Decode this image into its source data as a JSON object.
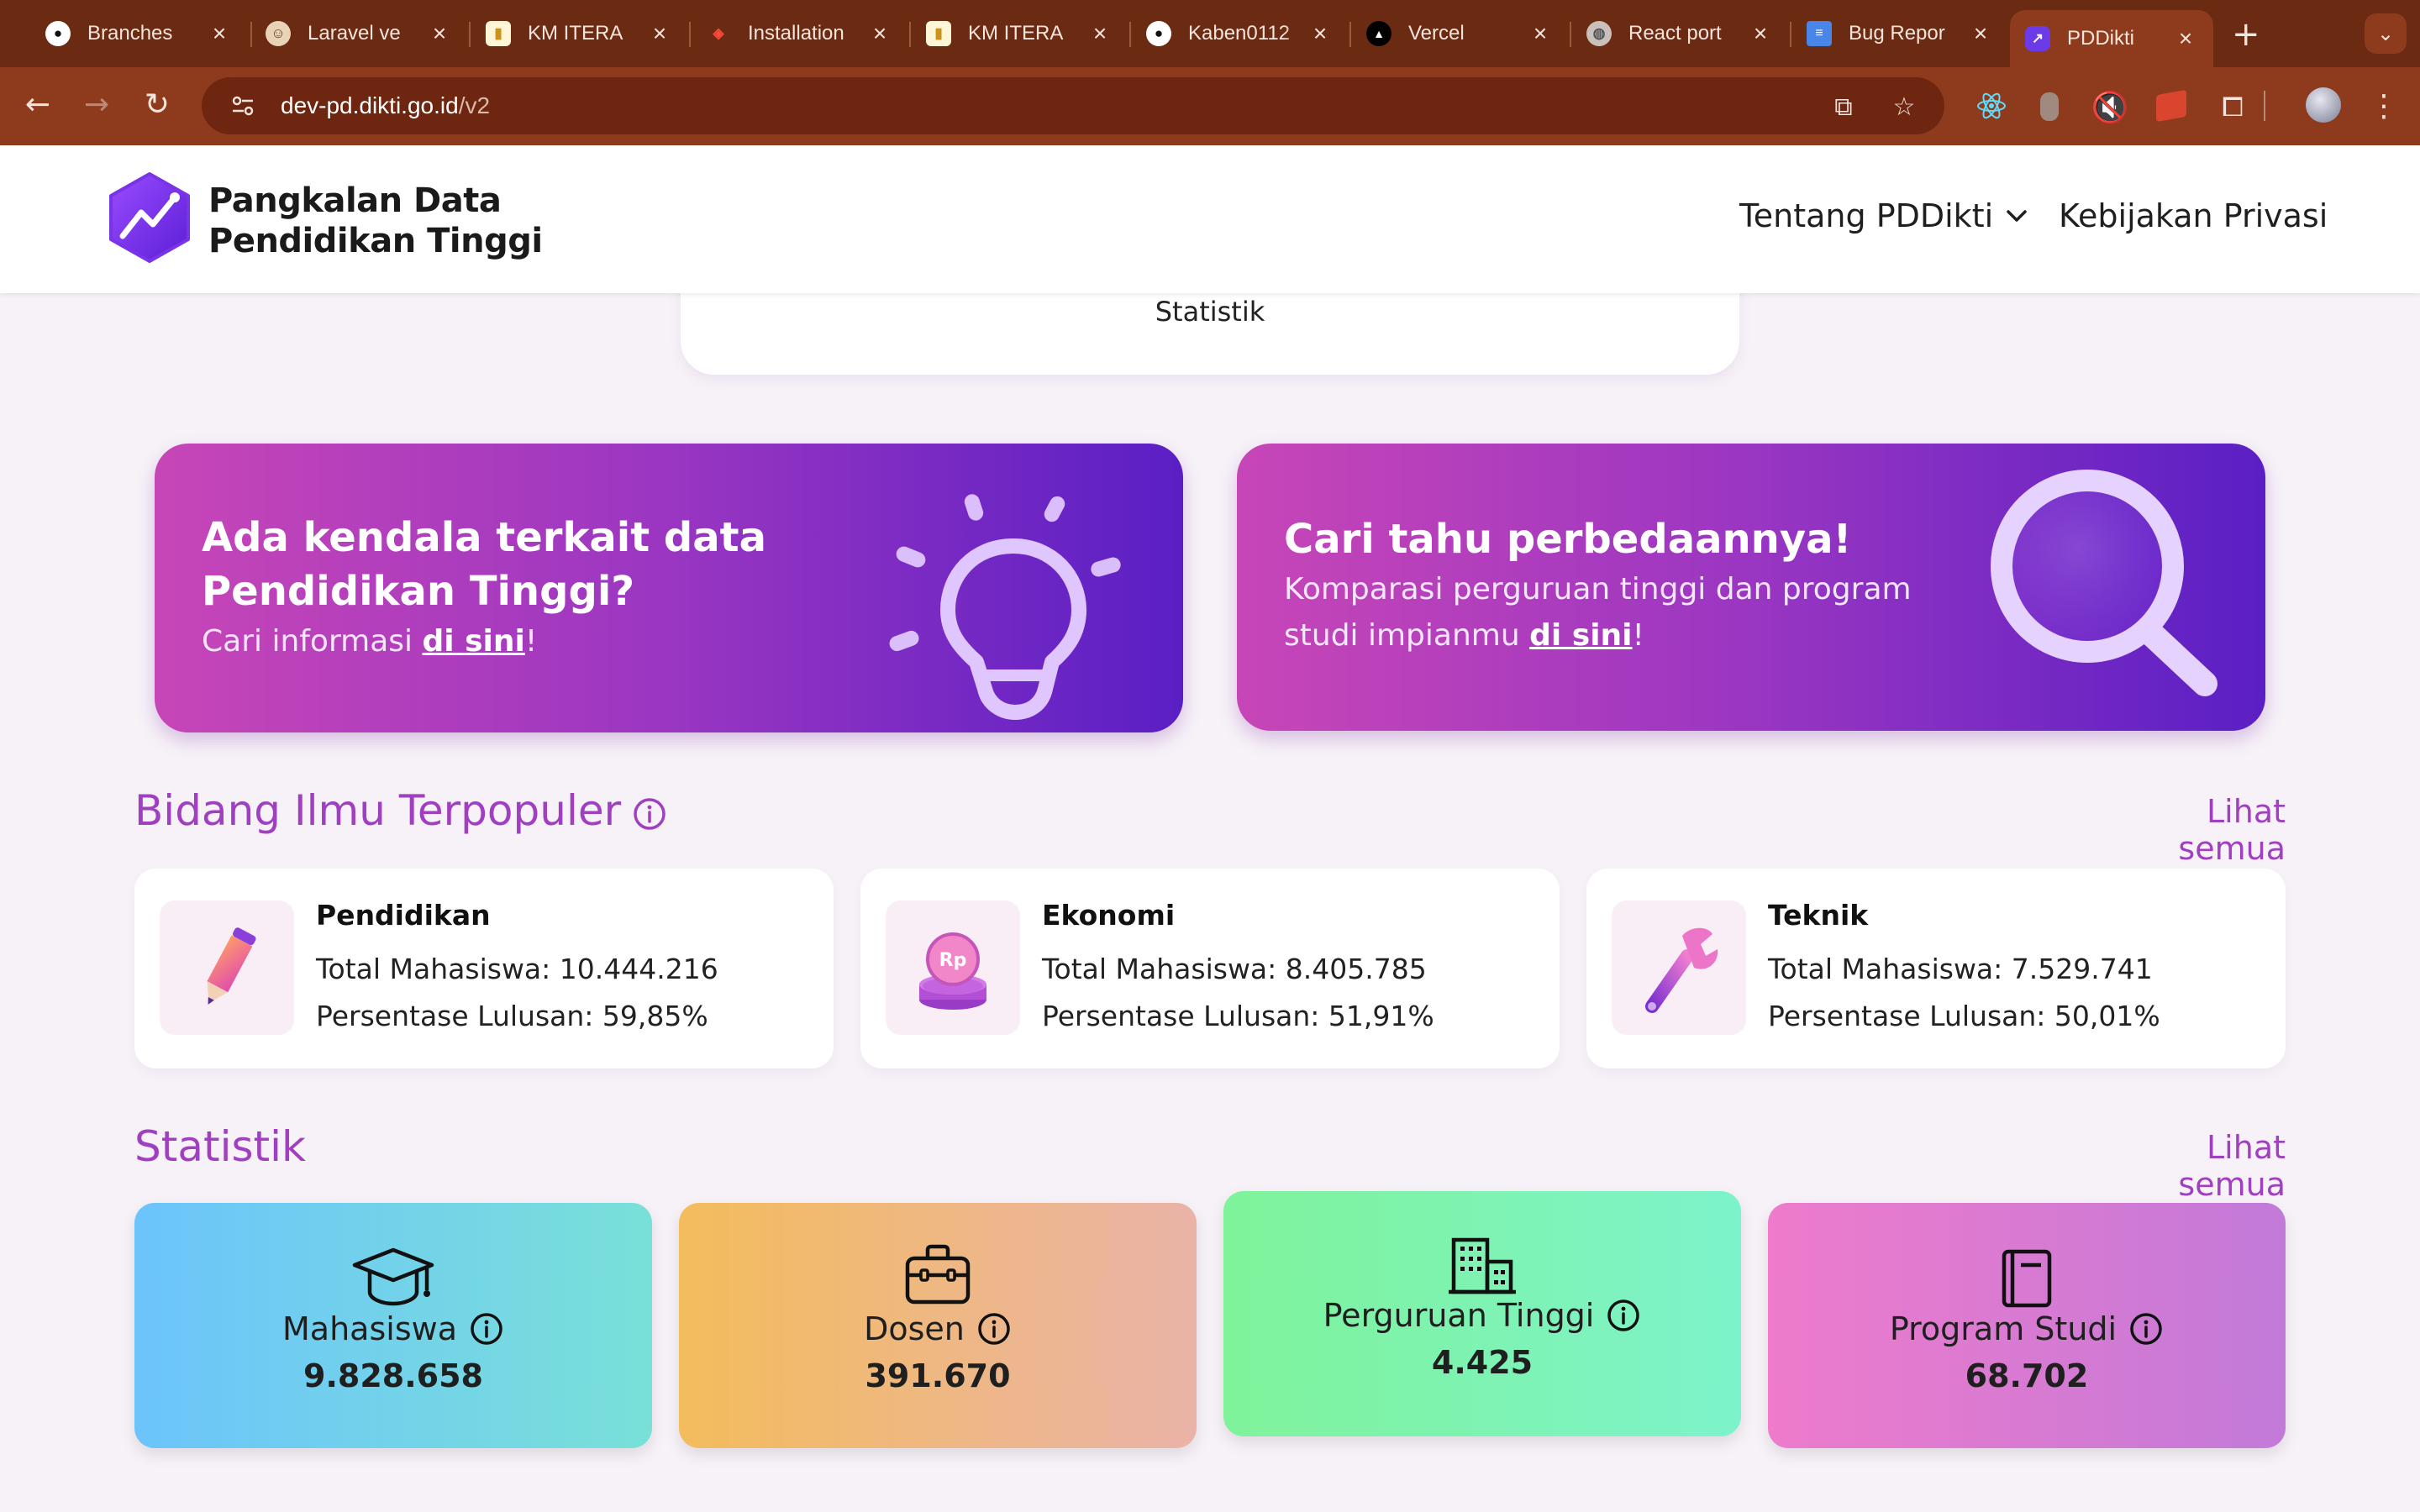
{
  "browser": {
    "tabs": [
      {
        "title": "Branches",
        "icon": "github-icon"
      },
      {
        "title": "Laravel ve",
        "icon": "laravel-avatar-icon"
      },
      {
        "title": "KM ITERA",
        "icon": "itera-icon"
      },
      {
        "title": "Installation",
        "icon": "laravel-icon"
      },
      {
        "title": "KM ITERA",
        "icon": "itera-icon"
      },
      {
        "title": "Kaben0112",
        "icon": "github-icon"
      },
      {
        "title": "Vercel",
        "icon": "vercel-icon"
      },
      {
        "title": "React port",
        "icon": "globe-icon"
      },
      {
        "title": "Bug Repor",
        "icon": "docs-icon"
      },
      {
        "title": "PDDikti",
        "icon": "pddikti-icon",
        "active": true
      }
    ],
    "url_host": "dev-pd.dikti.go.id",
    "url_path": "/v2"
  },
  "header": {
    "logo_line1": "Pangkalan Data",
    "logo_line2": "Pendidikan Tinggi",
    "menu_about": "Tentang PDDikti",
    "menu_privacy": "Kebijakan Privasi"
  },
  "top_card": {
    "label": "Statistik"
  },
  "promo_help": {
    "title_line1": "Ada kendala terkait data",
    "title_line2": "Pendidikan Tinggi?",
    "text_prefix": "Cari informasi ",
    "link": "di sini",
    "text_suffix": "!"
  },
  "promo_compare": {
    "title": "Cari tahu perbedaannya!",
    "text_line1": "Komparasi perguruan tinggi dan program",
    "text_line2_prefix": "studi impianmu ",
    "link": "di sini",
    "text_suffix": "!"
  },
  "popular": {
    "title": "Bidang Ilmu Terpopuler",
    "see_all": "Lihat semua",
    "items": [
      {
        "name": "Pendidikan",
        "students": "Total Mahasiswa: 10.444.216",
        "graduation": "Persentase Lulusan: 59,85%",
        "icon": "pencil-icon"
      },
      {
        "name": "Ekonomi",
        "students": "Total Mahasiswa: 8.405.785",
        "graduation": "Persentase Lulusan: 51,91%",
        "icon": "coins-icon"
      },
      {
        "name": "Teknik",
        "students": "Total Mahasiswa: 7.529.741",
        "graduation": "Persentase Lulusan: 50,01%",
        "icon": "wrench-icon"
      }
    ]
  },
  "statistics": {
    "title": "Statistik",
    "see_all": "Lihat semua",
    "cards": [
      {
        "label": "Mahasiswa",
        "value": "9.828.658",
        "icon": "graduation-cap-icon"
      },
      {
        "label": "Dosen",
        "value": "391.670",
        "icon": "briefcase-icon"
      },
      {
        "label": "Perguruan Tinggi",
        "value": "4.425",
        "icon": "building-icon"
      },
      {
        "label": "Program Studi",
        "value": "68.702",
        "icon": "book-icon"
      }
    ]
  },
  "colors": {
    "accent": "#a13fc1",
    "chrome": "#8e3a1c",
    "promo_start": "#c746b7",
    "promo_end": "#5a1fc4"
  }
}
